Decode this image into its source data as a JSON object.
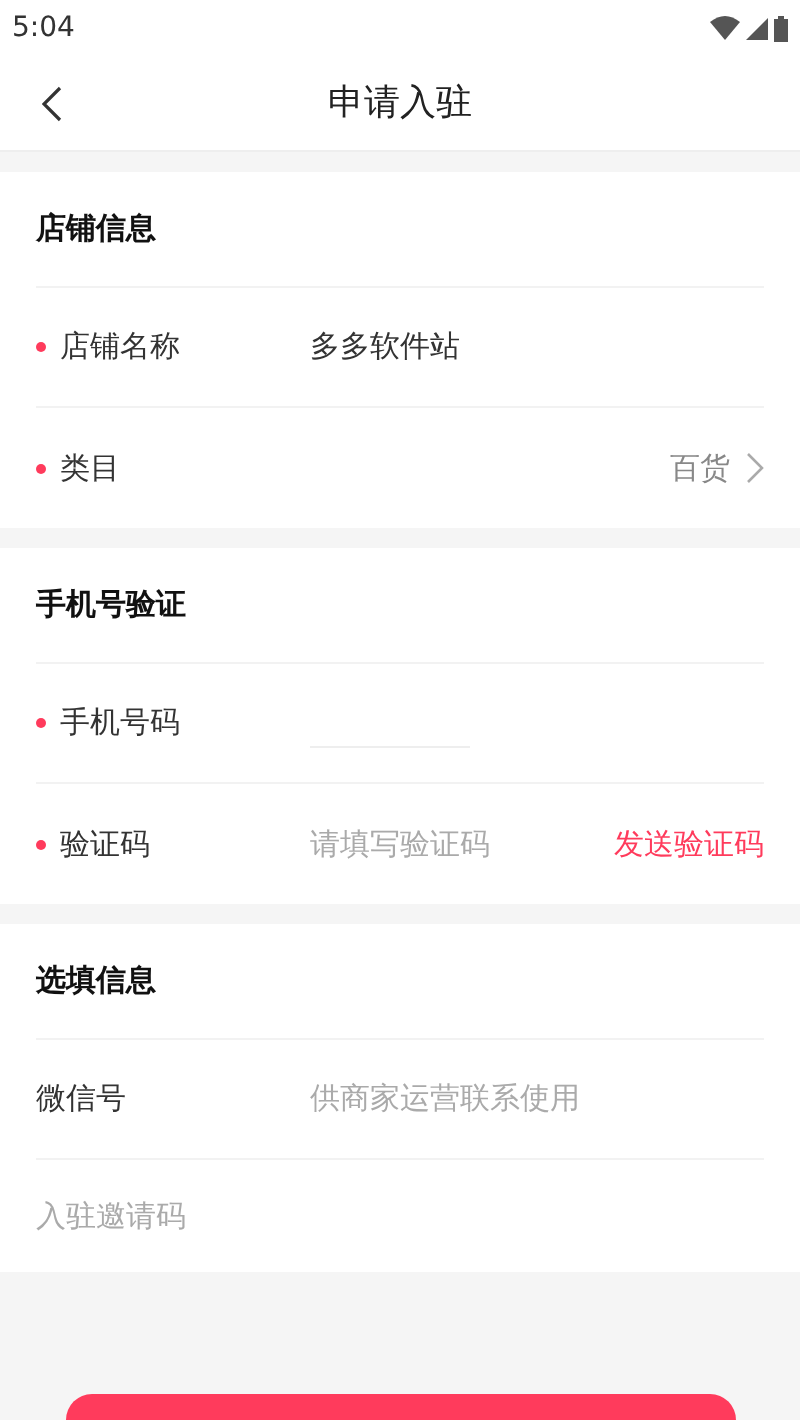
{
  "status_bar": {
    "time": "5:04"
  },
  "header": {
    "title": "申请入驻"
  },
  "sections": [
    {
      "title": "店铺信息",
      "rows": [
        {
          "kind": "text",
          "label": "店铺名称",
          "required": true,
          "value": "多多软件站"
        },
        {
          "kind": "select",
          "label": "类目",
          "required": true,
          "value": "百货"
        }
      ]
    },
    {
      "title": "手机号验证",
      "rows": [
        {
          "kind": "underline",
          "label": "手机号码",
          "required": true
        },
        {
          "kind": "code",
          "label": "验证码",
          "required": true,
          "placeholder": "请填写验证码",
          "action": "发送验证码"
        }
      ]
    },
    {
      "title": "选填信息",
      "rows": [
        {
          "kind": "input",
          "label": "微信号",
          "required": false,
          "placeholder": "供商家运营联系使用"
        },
        {
          "kind": "free",
          "required": false,
          "placeholder": "入驻邀请码"
        }
      ]
    }
  ]
}
